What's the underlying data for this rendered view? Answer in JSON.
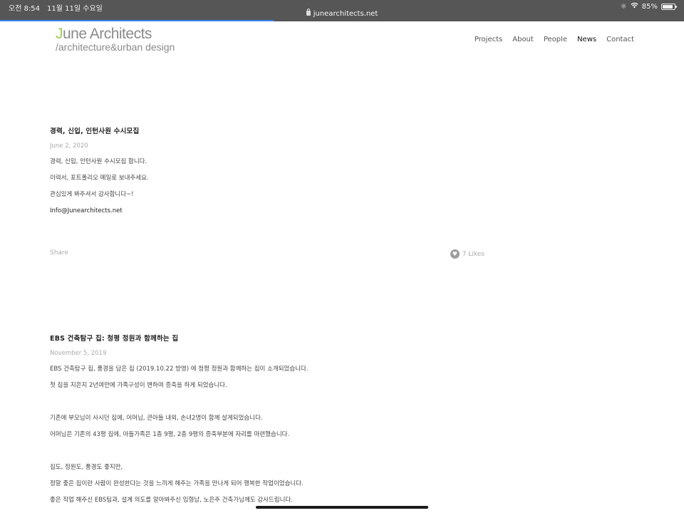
{
  "status_bar": {
    "time": "오전 8:54",
    "date": "11월 11일 수요일",
    "url": "junearchitects.net",
    "battery": "85%",
    "battery_level": 0.85,
    "page_load_progress": 0.4
  },
  "header": {
    "logo_accent": "J",
    "logo_rest": "une Architects",
    "logo_subtitle": "/architecture&urban design",
    "nav": [
      "Projects",
      "About",
      "People",
      "News",
      "Contact"
    ],
    "active_nav": "News"
  },
  "posts": [
    {
      "title": "경력, 신입, 인턴사원 수시모집",
      "date": "June 2, 2020",
      "paragraphs": [
        "경력, 신입, 인턴사원 수시모집 합니다.",
        "이력서, 포트폴리오 메일로 보내주세요.",
        "관심있게 봐주셔서 감사합니다~!",
        "Info@Junearchitects.net"
      ],
      "share_label": "Share",
      "likes_label": "7 Likes"
    },
    {
      "title": "EBS 건축탐구 집: 청평 정원과 함께하는 집",
      "date": "November 5, 2019",
      "paragraphs": [
        "EBS 건축탐구 집, 풍경을 담은 집 (2019.10.22 방영) 에 청평 정원과 함께하는 집이 소개되었습니다.",
        "첫 집을 지은지 2년여만에 가족구성이 변하여 증축을 하게 되었습니다.",
        "기존에 부모님이 사시던 집에, 어머님, 큰아들 내외, 손녀2명이 함께 살게되었습니다.",
        "어머님은 기존의 43평 집에, 아들가족은 1층 9평, 2층 9평의 증축부분에 자리를 마련했습니다.",
        "집도, 정원도, 풍경도 좋지만,",
        "정말 좋은 집이란 사람이 완성한다는 것을 느끼게 해주는 가족을 만나게 되어 행복한 작업이었습니다.",
        "좋은 작업 해주신 EBS팀과, 설계 의도를 알아봐주신 임형남, 노은주 건축가님께도 감사드립니다."
      ]
    }
  ]
}
